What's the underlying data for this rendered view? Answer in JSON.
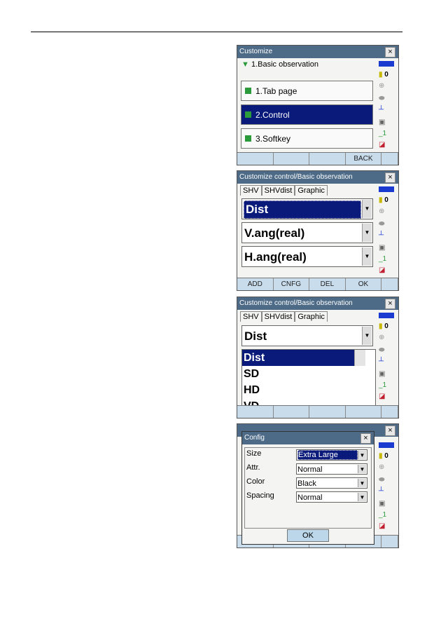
{
  "screen1": {
    "title": "Customize",
    "header": "1.Basic observation",
    "items": [
      "1.Tab page",
      "2.Control",
      "3.Softkey"
    ],
    "softkeys": [
      "",
      "",
      "",
      "BACK",
      ""
    ]
  },
  "screen2": {
    "title": "Customize control/Basic observation",
    "tabs": [
      "SHV",
      "SHVdist",
      "Graphic"
    ],
    "fields": [
      "Dist",
      "V.ang(real)",
      "H.ang(real)"
    ],
    "softkeys": [
      "ADD",
      "CNFG",
      "DEL",
      "OK",
      ""
    ]
  },
  "screen3": {
    "title": "Customize control/Basic observation",
    "tabs": [
      "SHV",
      "SHVdist",
      "Graphic"
    ],
    "field": "Dist",
    "options": [
      "Dist",
      "SD",
      "HD",
      "VD"
    ]
  },
  "screen4": {
    "title": "Config",
    "rows": [
      {
        "label": "Size",
        "value": "Extra Large"
      },
      {
        "label": "Attr.",
        "value": "Normal"
      },
      {
        "label": "Color",
        "value": "Black"
      },
      {
        "label": "Spacing",
        "value": "Normal"
      }
    ],
    "ok": "OK"
  },
  "status": {
    "count": "0",
    "battery_color": "#1a3ad0"
  }
}
